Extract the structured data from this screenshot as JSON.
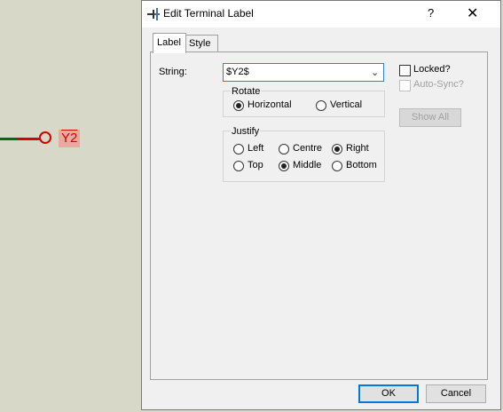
{
  "schematic": {
    "terminal_label": "Y2"
  },
  "dialog": {
    "title": "Edit Terminal Label",
    "help_glyph": "?",
    "close_glyph": "✕",
    "tabs": [
      {
        "label": "Label",
        "active": true
      },
      {
        "label": "Style",
        "active": false
      }
    ],
    "string_label": "String:",
    "string_value": "$Y2$",
    "locked_label": "Locked?",
    "autosync_label": "Auto-Sync?",
    "show_all_label": "Show All",
    "rotate": {
      "title": "Rotate",
      "options": [
        {
          "label": "Horizontal",
          "checked": true
        },
        {
          "label": "Vertical",
          "checked": false
        }
      ]
    },
    "justify": {
      "title": "Justify",
      "options": [
        {
          "label": "Left",
          "checked": false
        },
        {
          "label": "Centre",
          "checked": false
        },
        {
          "label": "Right",
          "checked": true
        },
        {
          "label": "Top",
          "checked": false
        },
        {
          "label": "Middle",
          "checked": true
        },
        {
          "label": "Bottom",
          "checked": false
        }
      ]
    },
    "ok_label": "OK",
    "cancel_label": "Cancel"
  },
  "colors": {
    "wire": "#0a6a0a",
    "terminal": "#d40000",
    "label_bg": "#e8aaa0",
    "focus": "#0078d7"
  }
}
